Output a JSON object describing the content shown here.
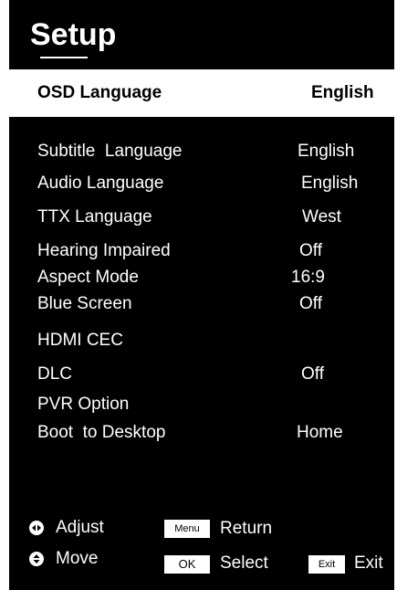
{
  "title": "Setup",
  "selected": {
    "label": "OSD Language",
    "value": "English"
  },
  "items": [
    {
      "label": "Subtitle  Language",
      "value": "English"
    },
    {
      "label": "Audio Language",
      "value": "English"
    },
    {
      "label": "TTX Language",
      "value": "West"
    },
    {
      "label": "Hearing Impaired",
      "value": "Off"
    },
    {
      "label": "Aspect Mode",
      "value": "16:9"
    },
    {
      "label": "Blue Screen",
      "value": "Off"
    },
    {
      "label": "HDMI CEC",
      "value": ""
    },
    {
      "label": "DLC",
      "value": "Off"
    },
    {
      "label": "PVR Option",
      "value": ""
    },
    {
      "label": "Boot  to Desktop",
      "value": "Home"
    }
  ],
  "footer": {
    "adjust": {
      "icon": "left-right-arrows-icon",
      "label": "Adjust"
    },
    "move": {
      "icon": "up-down-arrows-icon",
      "label": "Move"
    },
    "menu": {
      "key": "Menu",
      "label": "Return"
    },
    "ok": {
      "key": "OK",
      "label": "Select"
    },
    "exit": {
      "key": "Exit",
      "label": "Exit"
    }
  },
  "colors": {
    "background": "#000000",
    "highlight": "#ffffff",
    "text": "#ffffff"
  }
}
